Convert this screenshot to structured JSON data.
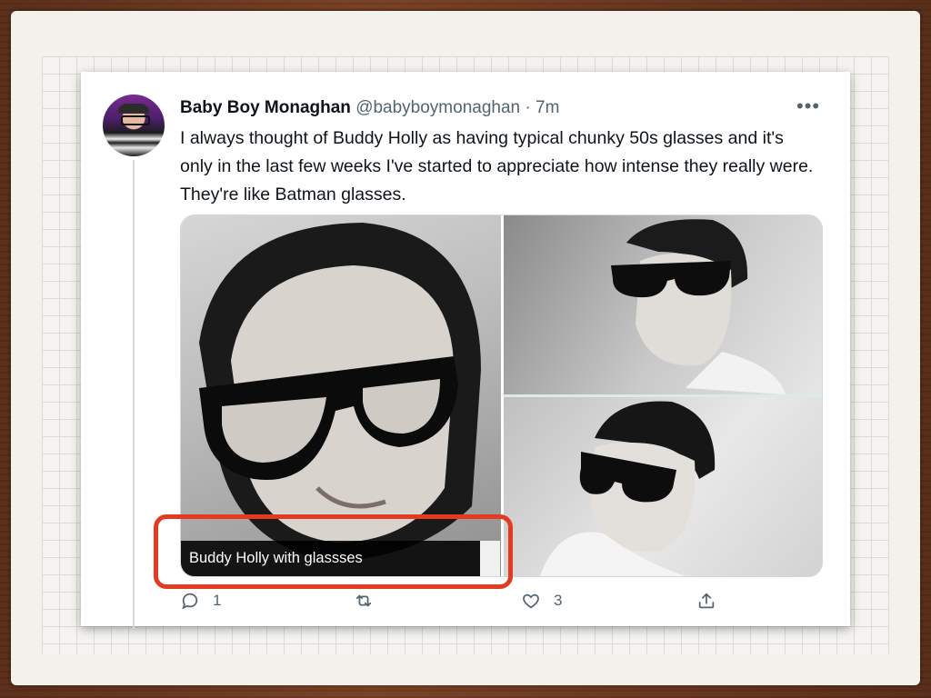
{
  "tweet": {
    "author_name": "Baby Boy Monaghan",
    "author_handle": "@babyboymonaghan",
    "time_separator": " · ",
    "timestamp": "7m",
    "more_icon": "more-horizontal-icon",
    "text": "I always thought of Buddy Holly as having typical chunky 50s glasses and it's only in the last few weeks I've started to appreciate how intense they really were. They're like Batman glasses."
  },
  "media": {
    "caption": "Buddy Holly with glassses"
  },
  "actions": {
    "reply_icon": "reply-icon",
    "reply_count": "1",
    "retweet_icon": "retweet-icon",
    "like_icon": "heart-icon",
    "like_count": "3",
    "share_icon": "share-icon"
  },
  "colors": {
    "highlight": "#e33b22",
    "secondary_text": "#536471"
  }
}
